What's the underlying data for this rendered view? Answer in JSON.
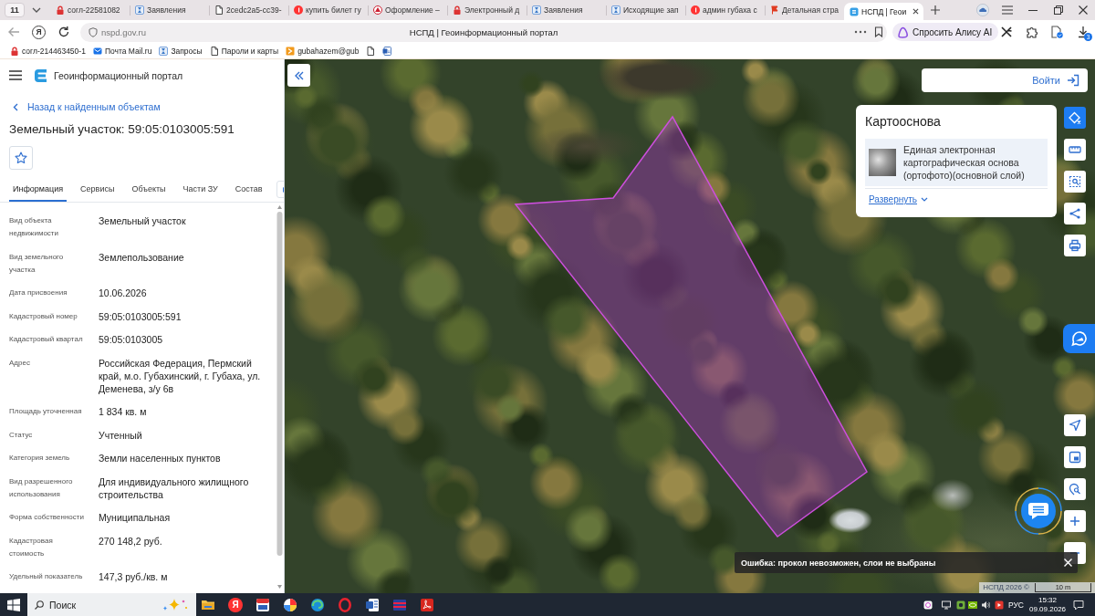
{
  "browser": {
    "tab_counter": "11",
    "tabs": [
      {
        "kind": "lock",
        "title": "согл-22581082",
        "selected": false
      },
      {
        "kind": "hourglass",
        "title": "Заявления",
        "selected": false
      },
      {
        "kind": "document",
        "title": "2cedc2a5-cc39-",
        "selected": false
      },
      {
        "kind": "yandex",
        "title": "купить билет гу",
        "selected": false
      },
      {
        "kind": "emblem",
        "title": "Оформление –",
        "selected": false
      },
      {
        "kind": "lock",
        "title": "Электронный д",
        "selected": false
      },
      {
        "kind": "hourglass",
        "title": "Заявления",
        "selected": false
      },
      {
        "kind": "hourglass",
        "title": "Исходящие зап",
        "selected": false
      },
      {
        "kind": "yandex",
        "title": "админ губаха с",
        "selected": false
      },
      {
        "kind": "flag",
        "title": "Детальная стра",
        "selected": false
      },
      {
        "kind": "portal",
        "title": "НСПД | Геои",
        "selected": true
      }
    ],
    "home_button": "Я",
    "url": "nspd.gov.ru",
    "page_title": "НСПД | Геоинформационный портал",
    "alice_button": "Спросить Алису AI",
    "downloads_badge": "3",
    "bookmarks": [
      {
        "kind": "lock",
        "title": "согл-214463450-1"
      },
      {
        "kind": "mail",
        "title": "Почта Mail.ru"
      },
      {
        "kind": "hourglass",
        "title": "Запросы"
      },
      {
        "kind": "document",
        "title": "Пароли и карты"
      },
      {
        "kind": "forward",
        "title": "gubahazem@gub"
      },
      {
        "kind": "document"
      },
      {
        "kind": "word"
      }
    ]
  },
  "portal": {
    "title": "Геоинформационный портал",
    "back_link": "Назад к найденным объектам",
    "object_title": "Земельный участок: 59:05:0103005:591",
    "favorite": false,
    "tabs": [
      {
        "label": "Информация",
        "selected": true
      },
      {
        "label": "Сервисы",
        "selected": false
      },
      {
        "label": "Объекты",
        "selected": false
      },
      {
        "label": "Части ЗУ",
        "selected": false
      },
      {
        "label": "Состав",
        "selected": false
      }
    ],
    "properties": [
      {
        "label": "Вид объекта недвижимости",
        "value": "Земельный участок"
      },
      {
        "label": "Вид земельного участка",
        "value": "Землепользование"
      },
      {
        "label": "Дата присвоения",
        "value": "10.06.2026"
      },
      {
        "label": "Кадастровый номер",
        "value": "59:05:0103005:591"
      },
      {
        "label": "Кадастровый квартал",
        "value": "59:05:0103005"
      },
      {
        "label": "Адрес",
        "value": "Российская Федерация, Пермский край, м.о. Губахинский, г. Губаха, ул. Деменева, з/у 6в"
      },
      {
        "label": "Площадь уточненная",
        "value": "1 834 кв. м"
      },
      {
        "label": "Статус",
        "value": "Учтенный"
      },
      {
        "label": "Категория земель",
        "value": "Земли населенных пунктов"
      },
      {
        "label": "Вид разрешенного использования",
        "value": "Для индивидуального жилищного строительства"
      },
      {
        "label": "Форма собственности",
        "value": "Муниципальная"
      },
      {
        "label": "Кадастровая стоимость",
        "value": "270 148,2 руб."
      },
      {
        "label": "Удельный показатель",
        "value": "147,3 руб./кв. м"
      }
    ]
  },
  "map": {
    "login_button": "Войти",
    "basemap": {
      "title": "Картооснова",
      "layer": "Единая электронная картографическая основа (ортофото)(основной слой)",
      "expand_link": "Развернуть"
    },
    "tools": [
      {
        "kind": "layers",
        "selected": true
      },
      {
        "kind": "ruler",
        "selected": false
      },
      {
        "kind": "select",
        "selected": false
      },
      {
        "kind": "share",
        "selected": false
      },
      {
        "kind": "print",
        "selected": false
      }
    ],
    "controls": [
      {
        "kind": "navigate"
      },
      {
        "kind": "minimap"
      },
      {
        "kind": "locate"
      },
      {
        "kind": "zoom_in"
      },
      {
        "kind": "zoom_out"
      }
    ],
    "error_message": "Ошибка: прокол невозможен, слои не выбраны",
    "attribution": "НСПД 2026 ©",
    "scale": "10 m"
  },
  "taskbar": {
    "search_placeholder": "Поиск",
    "apps": [
      {
        "kind": "folder"
      },
      {
        "kind": "letter",
        "label": "Я"
      },
      {
        "kind": "tile"
      },
      {
        "kind": "segmented"
      },
      {
        "kind": "swirl"
      },
      {
        "kind": "ring"
      },
      {
        "kind": "word"
      },
      {
        "kind": "striped"
      },
      {
        "kind": "pdf"
      }
    ],
    "language": "РУС",
    "time": "15:32",
    "date": "09.09.2026"
  }
}
